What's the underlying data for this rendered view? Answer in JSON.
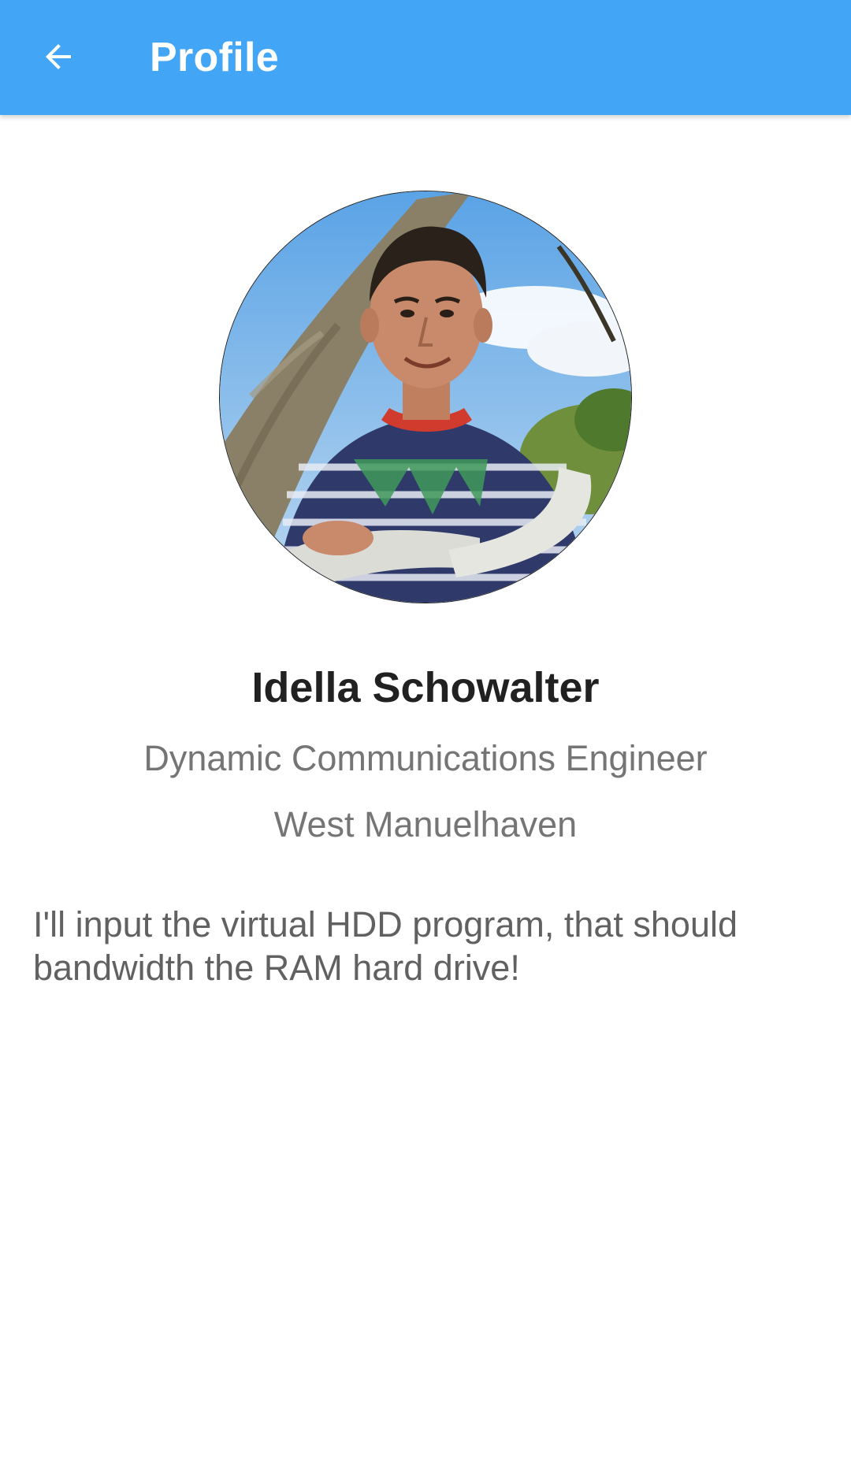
{
  "app_bar": {
    "title": "Profile",
    "back_icon": "arrow-back-icon",
    "background_color": "#42a5f5"
  },
  "profile": {
    "avatar_alt": "profile photo",
    "name": "Idella Schowalter",
    "job_title": "Dynamic Communications Engineer",
    "city": "West Manuelhaven",
    "bio": "I'll input the virtual HDD program, that should bandwidth the RAM hard drive!"
  },
  "colors": {
    "name_text": "#212121",
    "secondary_text": "#757575",
    "bio_text": "#616161"
  }
}
